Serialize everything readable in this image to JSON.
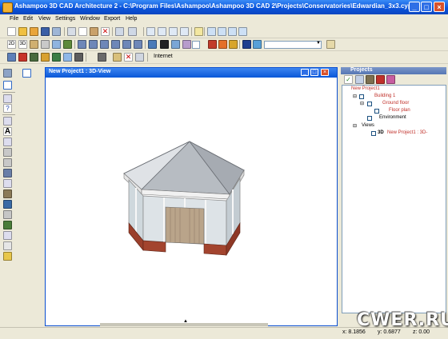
{
  "window": {
    "title": "Ashampoo 3D CAD Architecture 2 - C:\\Program Files\\Ashampoo\\Ashampoo 3D CAD 2\\Projects\\Conservatories\\Edwardian_3x3.cyp",
    "minimize": "_",
    "maximize": "□",
    "close": "×"
  },
  "menu": [
    "File",
    "Edit",
    "View",
    "Settings",
    "Window",
    "Export",
    "Help"
  ],
  "toolbar3": {
    "internet_label": "Internet"
  },
  "view": {
    "title": "New Project1 : 3D-View",
    "minimize": "_",
    "maximize": "□",
    "close": "×"
  },
  "panel": {
    "title": "Projects",
    "tree": {
      "root": "New Project1",
      "building": "Building 1",
      "ground_floor": "Ground floor",
      "floor_plan": "Floor plan",
      "environment": "Environment",
      "views": "Views",
      "view_item_prefix": "3D",
      "view_item": "New Project1 : 3D-"
    }
  },
  "status": {
    "x": "x: 8.1856",
    "y": "y: 0.6877",
    "z": "z: 0.00"
  },
  "watermark": "CWER.RU",
  "colors": {
    "titlebar": "#0a54dc",
    "frame": "#ece9d8",
    "tree_red": "#c0302a",
    "brick": "#a3442e"
  }
}
